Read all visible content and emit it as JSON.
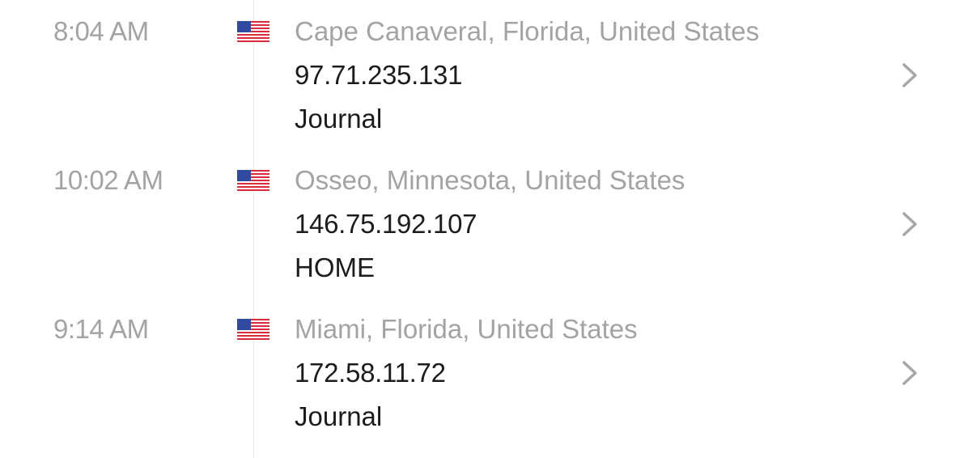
{
  "entries": [
    {
      "time": "10:02 AM",
      "flag_icon": "us-flag-icon",
      "location": "Osseo, Minnesota, United States",
      "ip": "146.75.192.107",
      "label": "HOME"
    },
    {
      "time": "9:14 AM",
      "flag_icon": "us-flag-icon",
      "location": "Miami, Florida, United States",
      "ip": "172.58.11.72",
      "label": "Journal"
    },
    {
      "time": "8:04 AM",
      "flag_icon": "us-flag-icon",
      "location": "Cape Canaveral, Florida, United States",
      "ip": "97.71.235.131",
      "label": "Journal"
    }
  ],
  "colors": {
    "secondary_text": "#a3a3a3",
    "primary_text": "#1c1c1c",
    "divider": "#e6e6e6",
    "chevron": "#a6a6a6",
    "flag_red": "#d92b3a",
    "flag_blue": "#2f4a9e"
  }
}
